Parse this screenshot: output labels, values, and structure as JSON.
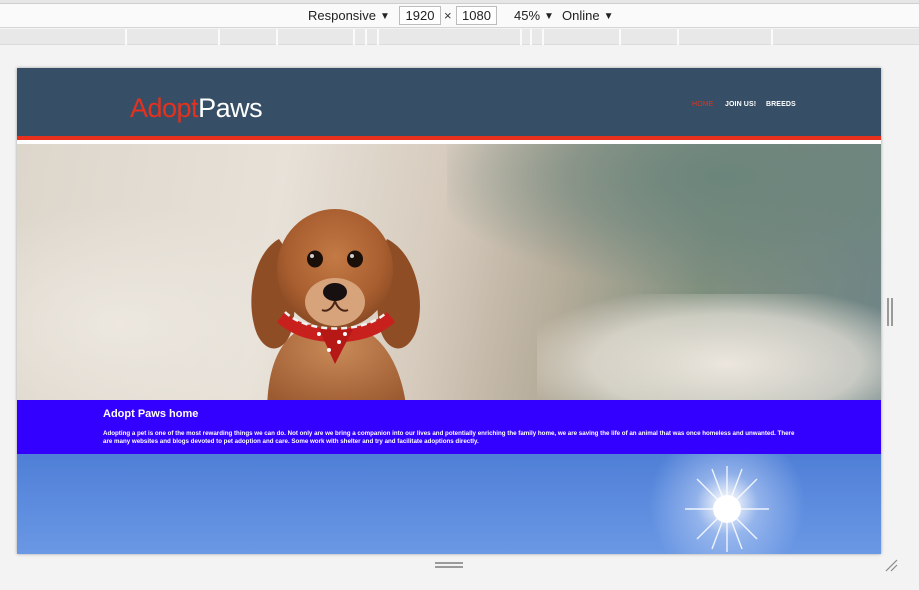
{
  "devtools": {
    "device": "Responsive",
    "width": "1920",
    "height": "1080",
    "times": "×",
    "zoom": "45%",
    "network": "Online"
  },
  "site": {
    "logo_part1": "Adopt",
    "logo_part2": "Paws",
    "nav": [
      "HOME",
      "JOIN US!",
      "BREEDS"
    ],
    "intro_title": "Adopt Paws home",
    "intro_text": "Adopting a pet is one of the most rewarding things we can do. Not only are we bring a companion into our lives and potentially enriching the family home, we are saving the life of an animal that was once homeless and unwanted. There are many websites and blogs devoted to pet adoption and care. Some work with shelter and try and facilitate adoptions directly."
  },
  "colors": {
    "header": "#364f66",
    "accent": "#e8301c",
    "intro_band": "#3300ff"
  }
}
